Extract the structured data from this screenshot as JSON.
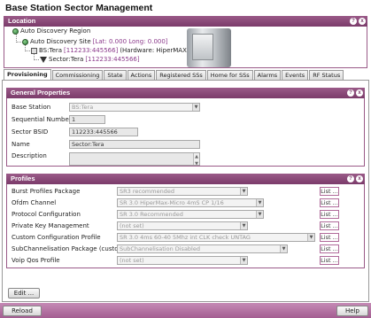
{
  "app": {
    "title": "Base Station Sector Management"
  },
  "location": {
    "header": "Location",
    "tree": {
      "region": "Auto Discovery Region",
      "site": "Auto Discovery Site",
      "site_coords": "[Lat: 0.000 Long: 0.000]",
      "bs_prefix": "BS:Tera",
      "bs_id": "[112233:445566]",
      "bs_hardware": "(Hardware: HiperMAX-micro)",
      "sector_prefix": "Sector:Tera",
      "sector_id": "[112233:445566]"
    }
  },
  "tabs": [
    "Provisioning",
    "Commissioning",
    "State",
    "Actions",
    "Registered SSs",
    "Home for SSs",
    "Alarms",
    "Events",
    "RF Status"
  ],
  "general": {
    "header": "General Properties",
    "base_station_label": "Base Station",
    "base_station_value": "BS:Tera",
    "seq_label": "Sequential Number",
    "seq_value": "1",
    "bsid_label": "Sector BSID",
    "bsid_value": "112233:445566",
    "name_label": "Name",
    "name_value": "Sector:Tera",
    "desc_label": "Description",
    "desc_value": ""
  },
  "profiles": {
    "header": "Profiles",
    "list_label": "List ...",
    "rows": [
      {
        "label": "Burst Profiles Package",
        "value": "SR3 recommended"
      },
      {
        "label": "Ofdm Channel",
        "value": "SR 3.0 HiperMax-Micro 4mS CP 1/16"
      },
      {
        "label": "Protocol Configuration",
        "value": "SR 3.0 Recommended"
      },
      {
        "label": "Private Key Management",
        "value": "(not set)"
      },
      {
        "label": "Custom Configuration Profile",
        "value": "SR 3.0 4ms 60-40 5Mhz int CLK check UNTAG"
      },
      {
        "label": "SubChannelisation Package (custom)",
        "value": "SubChannelisation Disabled"
      },
      {
        "label": "Voip Qos Profile",
        "value": "(not set)"
      }
    ]
  },
  "buttons": {
    "edit": "Edit ...",
    "reload": "Reload",
    "help": "Help"
  },
  "icons": {
    "help": "?",
    "close": "x"
  }
}
